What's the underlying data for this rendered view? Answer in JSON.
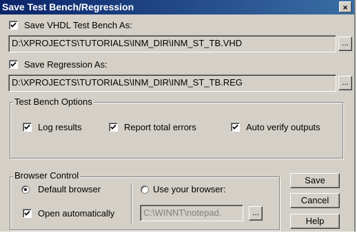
{
  "window": {
    "title": "Save Test Bench/Regression",
    "close_glyph": "×"
  },
  "save_vhdl": {
    "label": "Save VHDL Test Bench As:",
    "checked": true,
    "path": "D:\\XPROJECTS\\TUTORIALS\\INM_DIR\\INM_ST_TB.VHD",
    "browse": "..."
  },
  "save_regression": {
    "label": "Save Regression As:",
    "checked": true,
    "path": "D:\\XPROJECTS\\TUTORIALS\\INM_DIR\\INM_ST_TB.REG",
    "browse": "..."
  },
  "test_bench_options": {
    "title": "Test Bench Options",
    "log_results": "Log results",
    "report_total_errors": "Report total errors",
    "auto_verify_outputs": "Auto verify outputs"
  },
  "browser_control": {
    "title": "Browser Control",
    "default_browser": "Default browser",
    "use_your_browser": "Use your browser:",
    "open_automatically": "Open automatically",
    "browser_path": "C:\\WINNT\\notepad.",
    "browse": "..."
  },
  "buttons": {
    "save": "Save",
    "cancel": "Cancel",
    "help": "Help"
  }
}
